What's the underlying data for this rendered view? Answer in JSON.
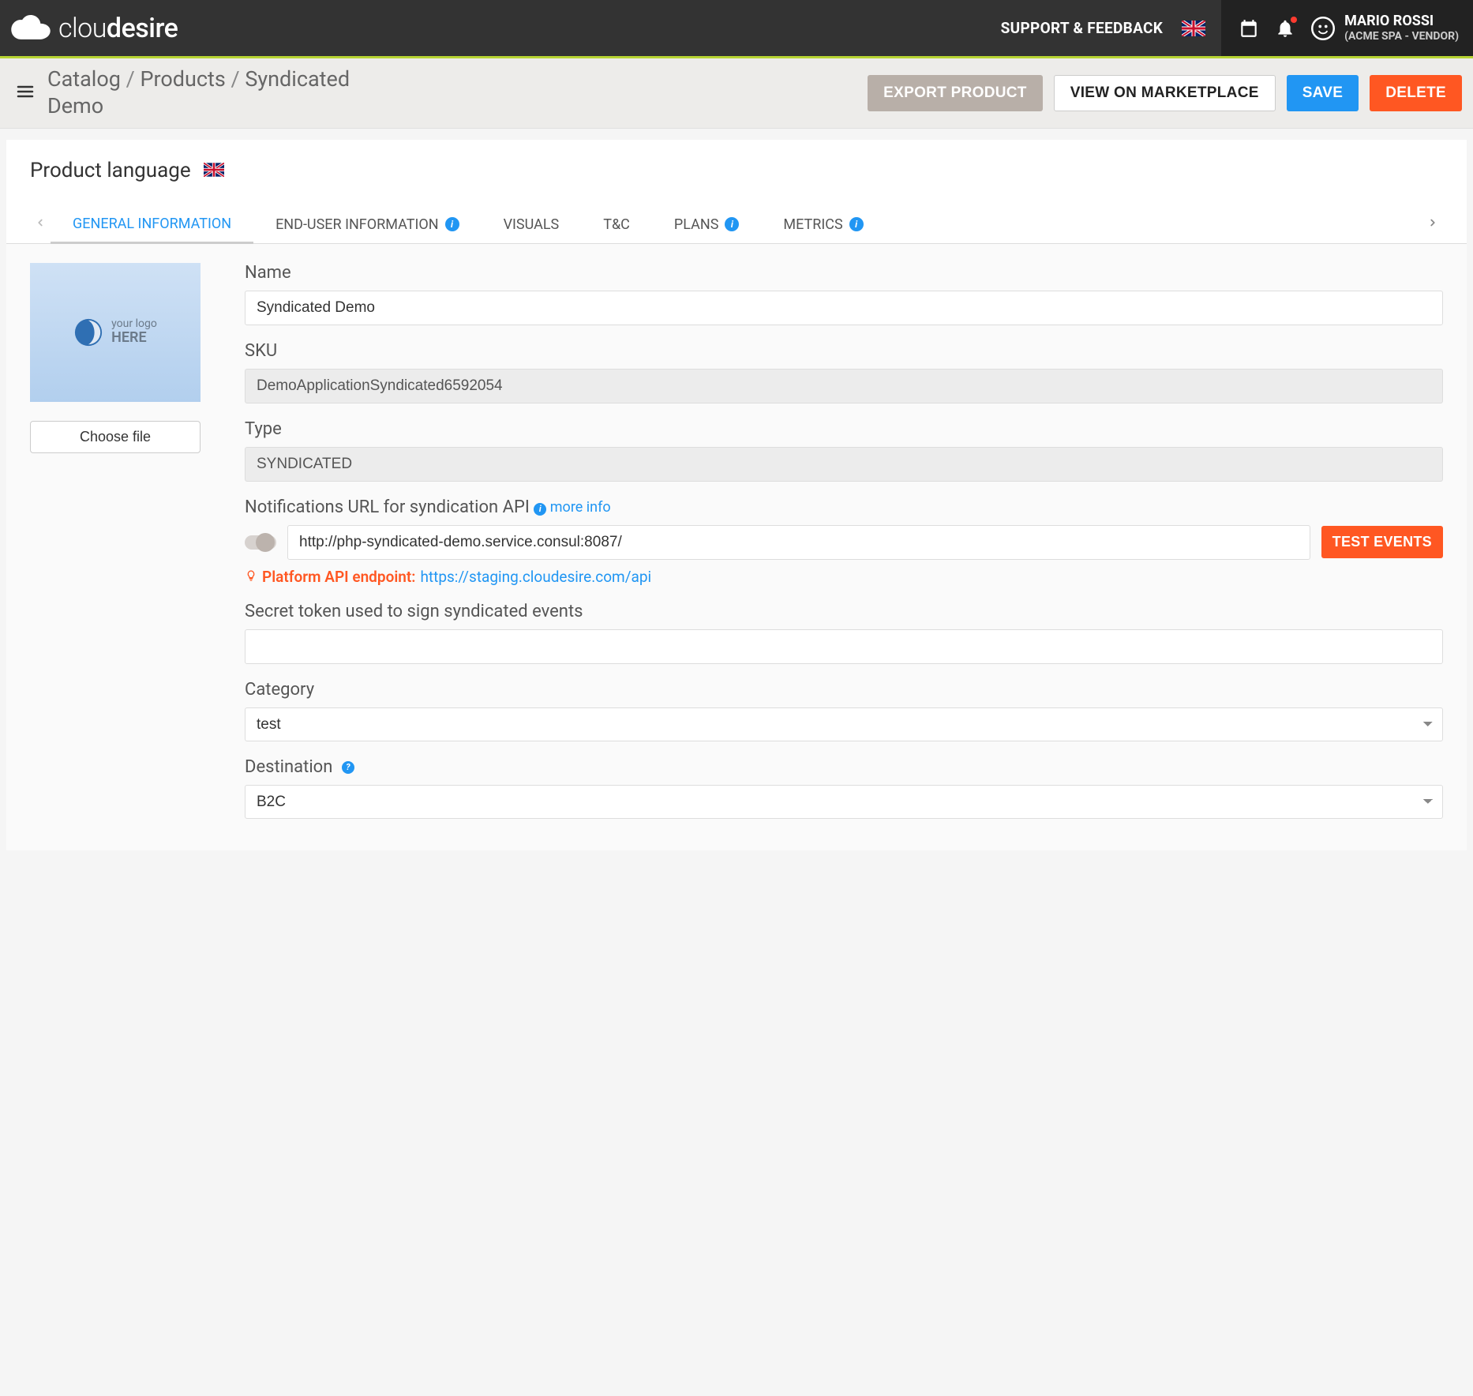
{
  "header": {
    "brand_prefix": "clou",
    "brand_suffix": "desire",
    "support_link": "SUPPORT & FEEDBACK",
    "user": {
      "name": "MARIO ROSSI",
      "org": "(ACME SPA - VENDOR)"
    }
  },
  "breadcrumb": {
    "seg1": "Catalog",
    "seg2": "Products",
    "seg3": "Syndicated Demo"
  },
  "actions": {
    "export": "EXPORT PRODUCT",
    "view": "VIEW ON MARKETPLACE",
    "save": "SAVE",
    "delete": "DELETE"
  },
  "language_label": "Product language",
  "tabs": [
    "GENERAL INFORMATION",
    "END-USER INFORMATION",
    "VISUALS",
    "T&C",
    "PLANS",
    "METRICS"
  ],
  "logo_placeholder": {
    "line1": "your logo",
    "line2": "HERE"
  },
  "choose_file": "Choose file",
  "form": {
    "name_label": "Name",
    "name_value": "Syndicated Demo",
    "sku_label": "SKU",
    "sku_value": "DemoApplicationSyndicated6592054",
    "type_label": "Type",
    "type_value": "SYNDICATED",
    "notif_label": "Notifications URL for syndication API",
    "more_info": "more info",
    "notif_value": "http://php-syndicated-demo.service.consul:8087/",
    "test_events": "TEST EVENTS",
    "endpoint_label": "Platform API endpoint",
    "endpoint_url": "https://staging.cloudesire.com/api",
    "secret_label": "Secret token used to sign syndicated events",
    "secret_value": "",
    "category_label": "Category",
    "category_value": "test",
    "destination_label": "Destination",
    "destination_value": "B2C"
  }
}
